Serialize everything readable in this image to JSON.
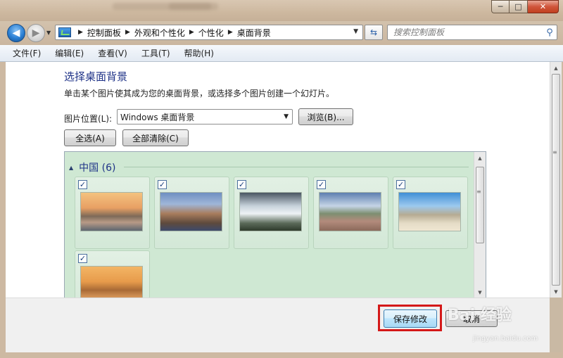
{
  "window": {
    "controls": {
      "minimize": "─",
      "maximize": "□",
      "close": "✕"
    }
  },
  "address_bar": {
    "crumbs": [
      "控制面板",
      "外观和个性化",
      "个性化",
      "桌面背景"
    ],
    "search_placeholder": "搜索控制面板"
  },
  "menu": {
    "items": [
      "文件(F)",
      "编辑(E)",
      "查看(V)",
      "工具(T)",
      "帮助(H)"
    ]
  },
  "page": {
    "title": "选择桌面背景",
    "description": "单击某个图片使其成为您的桌面背景，或选择多个图片创建一个幻灯片。",
    "location_label": "图片位置(L):",
    "location_value": "Windows 桌面背景",
    "browse_button": "浏览(B)...",
    "select_all_button": "全选(A)",
    "clear_all_button": "全部清除(C)"
  },
  "gallery": {
    "group_title": "中国 (6)",
    "items": [
      {
        "checked": true,
        "picture": "li-river-karst-sunset"
      },
      {
        "checked": true,
        "picture": "great-wall"
      },
      {
        "checked": true,
        "picture": "huangshan-mountains"
      },
      {
        "checked": true,
        "picture": "rice-terraces"
      },
      {
        "checked": true,
        "picture": "stone-forest-beach"
      },
      {
        "checked": true,
        "picture": "seventeen-arch-bridge-sunset"
      }
    ],
    "check_glyph": "✓"
  },
  "footer": {
    "save_button": "保存修改",
    "cancel_button": "取消",
    "watermark": "Bai 经验",
    "watermark_sub": "jingyan.baidu.com"
  },
  "colors": {
    "title_blue": "#1e3287",
    "gallery_bg": "#cfe8d3",
    "highlight_red": "#d41818"
  }
}
